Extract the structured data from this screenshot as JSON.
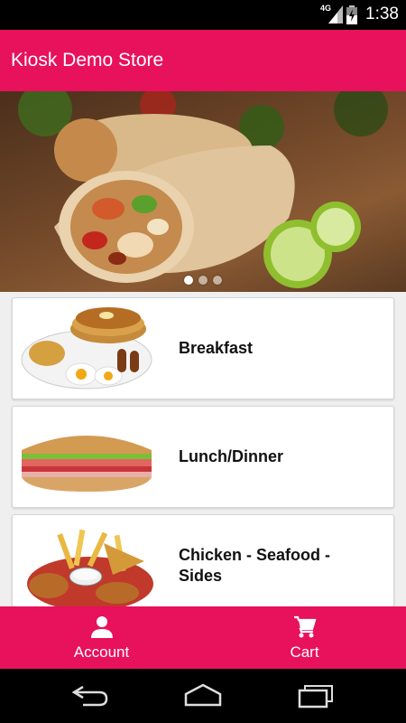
{
  "status_bar": {
    "network": "4G",
    "time": "1:38"
  },
  "app_bar": {
    "title": "Kiosk Demo Store"
  },
  "hero": {
    "slides": 3,
    "active_slide": 1
  },
  "menu": {
    "items": [
      {
        "label": "Breakfast",
        "icon": "breakfast-plate"
      },
      {
        "label": "Lunch/Dinner",
        "icon": "sub-sandwich"
      },
      {
        "label": "Chicken - Seafood - Sides",
        "icon": "chicken-fries-basket"
      }
    ]
  },
  "bottom_nav": {
    "account_label": "Account",
    "cart_label": "Cart"
  },
  "colors": {
    "brand": "#e8115b",
    "status_bar": "#000000"
  }
}
